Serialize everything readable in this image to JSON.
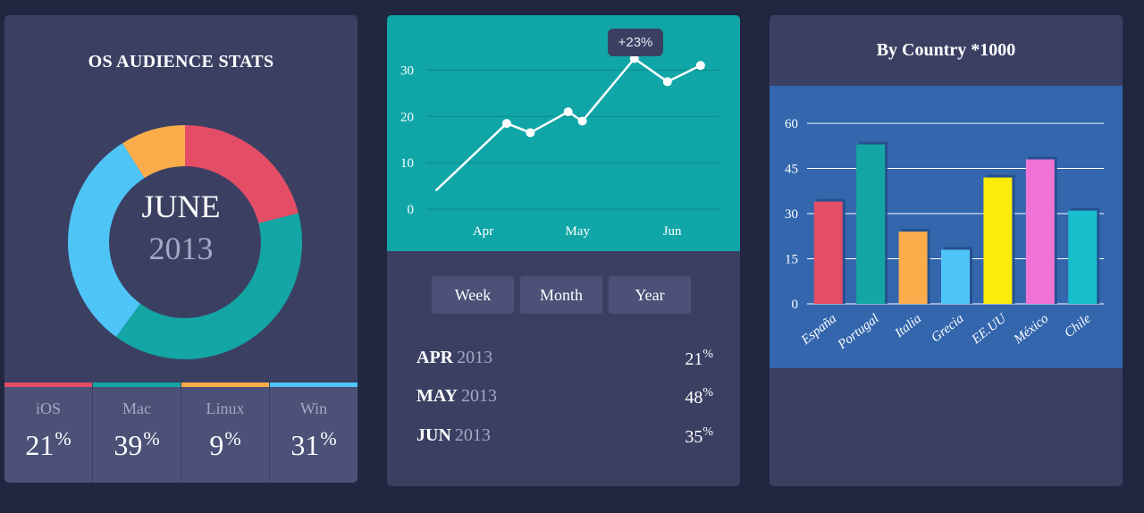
{
  "os_card": {
    "title": "OS AUDIENCE STATS",
    "center_month": "JUNE",
    "center_year": "2013",
    "items": [
      {
        "name": "iOS",
        "value": "21",
        "unit": "%",
        "color": "#e44d66"
      },
      {
        "name": "Mac",
        "value": "39",
        "unit": "%",
        "color": "#13a6a4"
      },
      {
        "name": "Linux",
        "value": "9",
        "unit": "%",
        "color": "#fbad4b"
      },
      {
        "name": "Win",
        "value": "31",
        "unit": "%",
        "color": "#4fc4f7"
      }
    ]
  },
  "trend_card": {
    "tooltip": "+23%",
    "buttons": [
      "Week",
      "Month",
      "Year"
    ],
    "stats": [
      {
        "month": "APR",
        "year": "2013",
        "value": "21",
        "unit": "%"
      },
      {
        "month": "MAY",
        "year": "2013",
        "value": "48",
        "unit": "%"
      },
      {
        "month": "JUN",
        "year": "2013",
        "value": "35",
        "unit": "%"
      }
    ]
  },
  "country_card": {
    "title": "By Country *1000"
  },
  "chart_data": [
    {
      "type": "pie",
      "title": "OS AUDIENCE STATS",
      "variant": "donut",
      "labels": [
        "iOS",
        "Mac",
        "Linux",
        "Win"
      ],
      "values": [
        21,
        39,
        9,
        31
      ],
      "colors": [
        "#e44d66",
        "#13a6a4",
        "#fbad4b",
        "#4fc4f7"
      ],
      "slice_order": [
        "iOS",
        "Mac",
        "Win",
        "Linux"
      ]
    },
    {
      "type": "line",
      "x": [
        0,
        1.5,
        2.0,
        2.8,
        3.1,
        4.2,
        4.9,
        5.6
      ],
      "y": [
        4,
        18.5,
        16.5,
        21,
        19,
        32.5,
        27.5,
        31
      ],
      "xticks": [
        {
          "pos": 1,
          "label": "Apr"
        },
        {
          "pos": 3,
          "label": "May"
        },
        {
          "pos": 5,
          "label": "Jun"
        }
      ],
      "xlim": [
        -0.2,
        6.0
      ],
      "yticks": [
        0,
        10,
        20,
        30
      ],
      "ylim": [
        0,
        38
      ],
      "grid": true,
      "line_color": "#ffffff",
      "background": "#10a6a8"
    },
    {
      "type": "bar",
      "title": "By Country *1000",
      "categories": [
        "España",
        "Portugal",
        "Italia",
        "Grecia",
        "EE.UU",
        "México",
        "Chile"
      ],
      "values": [
        34,
        53,
        24,
        18,
        42,
        48,
        31
      ],
      "colors": [
        "#e44d66",
        "#13a6a4",
        "#fbad4b",
        "#4fc4f7",
        "#fcec0c",
        "#f273d6",
        "#16bfcb"
      ],
      "yticks": [
        0,
        15,
        30,
        45,
        60
      ],
      "ylim": [
        0,
        60
      ],
      "grid": true,
      "background": "#3366ad"
    }
  ]
}
